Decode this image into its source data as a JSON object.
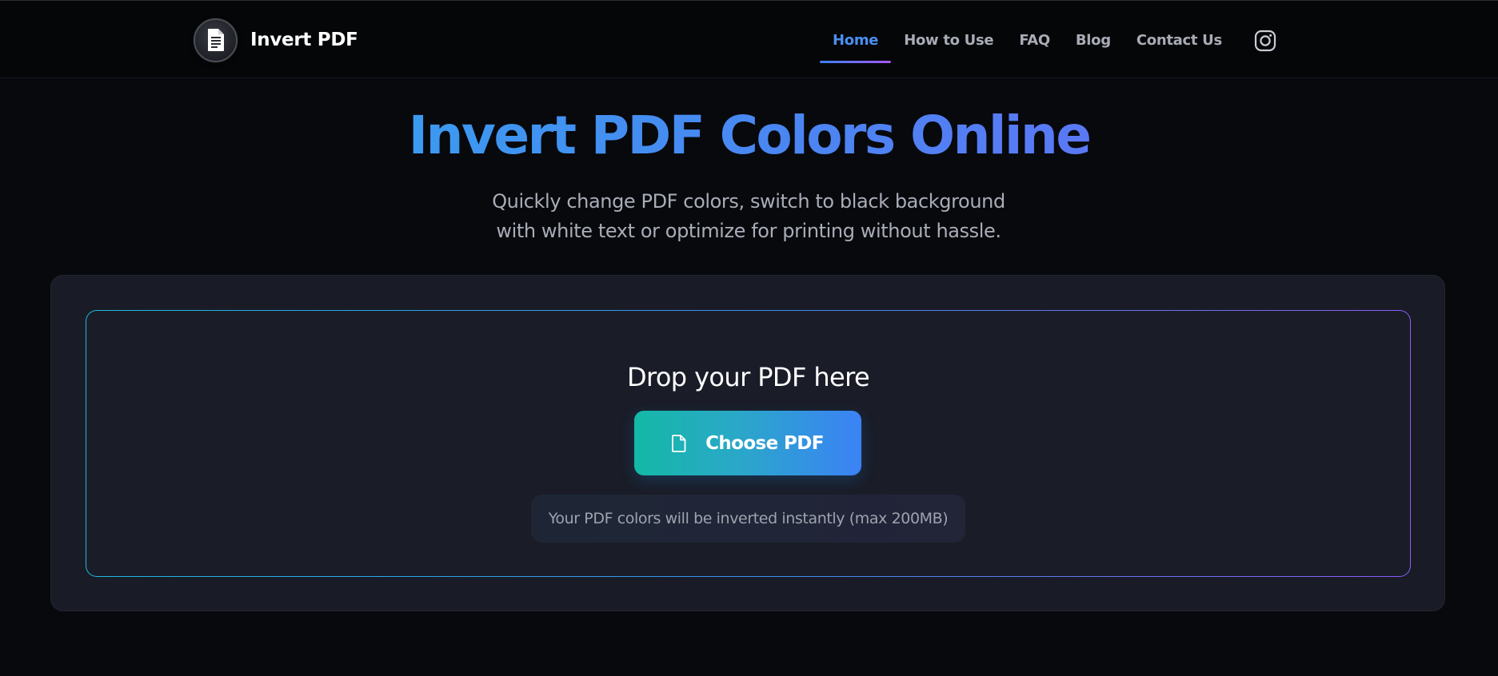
{
  "header": {
    "brand": {
      "name": "Invert PDF",
      "logo_icon": "document-icon"
    },
    "nav": [
      {
        "label": "Home",
        "active": true
      },
      {
        "label": "How to Use",
        "active": false
      },
      {
        "label": "FAQ",
        "active": false
      },
      {
        "label": "Blog",
        "active": false
      },
      {
        "label": "Contact Us",
        "active": false
      }
    ],
    "social_icon": "instagram-icon"
  },
  "hero": {
    "title": "Invert PDF Colors Online",
    "subtitle_line1": "Quickly change PDF colors, switch to black background",
    "subtitle_line2": "with white text or optimize for printing without hassle."
  },
  "upload": {
    "drop_title": "Drop your PDF here",
    "button_label": "Choose PDF",
    "button_icon": "file-icon",
    "hint": "Your PDF colors will be inverted instantly (max 200MB)"
  },
  "colors": {
    "background": "#08090d",
    "header_bg": "#050608",
    "card_bg": "#191c26",
    "accent_blue": "#3b82f6",
    "accent_teal": "#14b8a6",
    "accent_purple": "#a855f7",
    "nav_active": "#4a8ff0"
  }
}
